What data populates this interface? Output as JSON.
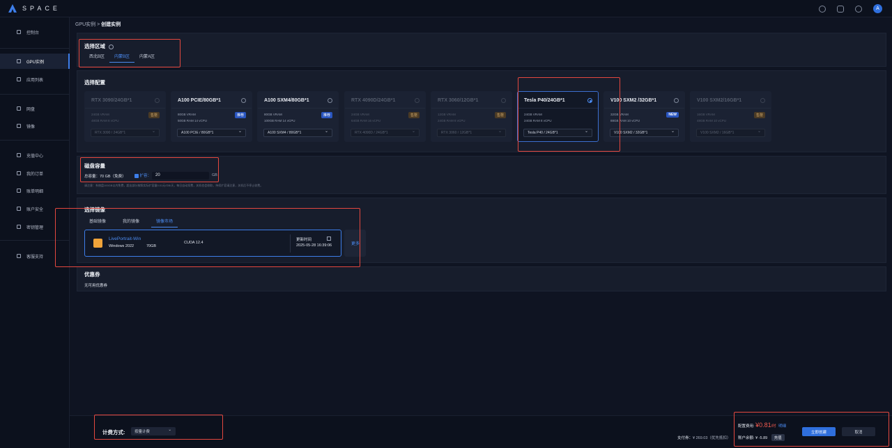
{
  "brand": {
    "name": "SPACE",
    "avatar_letter": "A"
  },
  "topbar_icons": [
    "settings-icon",
    "document-icon",
    "message-icon"
  ],
  "sidebar": {
    "items": [
      {
        "label": "控制台",
        "icon": "home-icon"
      },
      {
        "label": "GPU实例",
        "icon": "gpu-icon",
        "active": true
      },
      {
        "label": "应用列表",
        "icon": "cube-icon"
      },
      {
        "label": "网盘",
        "icon": "drive-icon"
      },
      {
        "label": "镜像",
        "icon": "disc-icon"
      },
      {
        "label": "充值中心",
        "icon": "recharge-icon"
      },
      {
        "label": "我的订单",
        "icon": "order-icon"
      },
      {
        "label": "账单明细",
        "icon": "bill-icon"
      },
      {
        "label": "账户安全",
        "icon": "shield-icon"
      },
      {
        "label": "密钥管理",
        "icon": "key-icon"
      },
      {
        "label": "客服支持",
        "icon": "chat-icon"
      }
    ]
  },
  "breadcrumb": {
    "parent": "GPU实例",
    "separator": ">",
    "current": "创建实例"
  },
  "region": {
    "title": "选择区域",
    "tabs": [
      "西北B区",
      "内蒙B区",
      "内蒙A区"
    ],
    "active_tab": 1
  },
  "config": {
    "title": "选择配置",
    "gpus": [
      {
        "name": "RTX 3090/24GB*1",
        "vram": "24GB VRAM",
        "ram": "48GB RAM 8 vCPU",
        "badge": "售罄",
        "badge_type": "soldout",
        "select": "RTX 3090 / 24GB*1",
        "state": "disabled"
      },
      {
        "name": "A100 PCIE/80GB*1",
        "vram": "80GB VRAM",
        "ram": "50GB RAM 14 vCPU",
        "badge": "推荐",
        "badge_type": "rec",
        "select": "A100 PCIE / 80GB*1",
        "state": "normal"
      },
      {
        "name": "A100 SXM4/80GB*1",
        "vram": "80GB VRAM",
        "ram": "100GB RAM 14 vCPU",
        "badge": "推荐",
        "badge_type": "rec",
        "select": "A100 SXM4 / 80GB*1",
        "state": "normal"
      },
      {
        "name": "RTX 4090D/24GB*1",
        "vram": "24GB VRAM",
        "ram": "64GB RAM 16 vCPU",
        "badge": "售罄",
        "badge_type": "soldout",
        "select": "RTX 4090D / 24GB*1",
        "state": "disabled"
      },
      {
        "name": "RTX 3060/12GB*1",
        "vram": "12GB VRAM",
        "ram": "24GB RAM 8 vCPU",
        "badge": "售罄",
        "badge_type": "soldout",
        "select": "RTX 3060 / 12GB*1",
        "state": "disabled"
      },
      {
        "name": "Tesla P40/24GB*1",
        "vram": "24GB VRAM",
        "ram": "24GB RAM 8 vCPU",
        "badge": "",
        "badge_type": "",
        "select": "Tesla P40 / 24GB*1",
        "state": "selected"
      },
      {
        "name": "V100 SXM2 /32GB*1",
        "vram": "32GB VRAM",
        "ram": "88GB RAM 10 vCPU",
        "badge": "NEW",
        "badge_type": "new",
        "select": "V100 SXM2 / 32GB*1",
        "state": "normal"
      },
      {
        "name": "V100 SXM2/16GB*1",
        "vram": "16GB VRAM",
        "ram": "48GB RAM 10 vCPU",
        "badge": "售罄",
        "badge_type": "soldout",
        "select": "V100 SXM2 / 16GB*1",
        "state": "disabled"
      }
    ]
  },
  "disk": {
    "title": "磁盘容量",
    "total_label": "总容量：70 GB（免费）",
    "expand_label": "扩容：",
    "expand_value": "20",
    "unit": "GB",
    "note": "请注意：系统盘100GB以内免费，超出部分按照实际扩容量0.01元/GB/天，每日自动扣费，关机也会收取，持续扩容请注意，关机后不停止收费。"
  },
  "image": {
    "title": "选择镜像",
    "tabs": [
      "基础镜像",
      "我的镜像",
      "镜像市场"
    ],
    "active_tab": 2,
    "selected": {
      "name": "LivePortrait-Win",
      "os": "Windows 2022",
      "size": "70GB",
      "cuda": "CUDA 12.4",
      "update_label": "更新时间",
      "update_time": "2025-05-28 16:39:06"
    },
    "more_label": "更多"
  },
  "coupon": {
    "title": "优惠券",
    "empty": "无可用优惠券"
  },
  "footer": {
    "billing_label": "计费方式:",
    "billing_value": "按量计费",
    "paid_label": "支付券：",
    "paid_value": "¥ 269.03（优先抵扣）",
    "cost_label": "配置费用:",
    "cost_value": "¥0.81",
    "cost_unit": "/时",
    "cost_detail": "明细",
    "balance_label": "账户余额:",
    "balance_value": "¥ -5.89",
    "recharge_label": "充值",
    "create_label": "立即创建",
    "cancel_label": "取消"
  },
  "colors": {
    "accent": "#3d7eea",
    "highlight_box": "#e5483f",
    "price": "#f05a4f"
  }
}
